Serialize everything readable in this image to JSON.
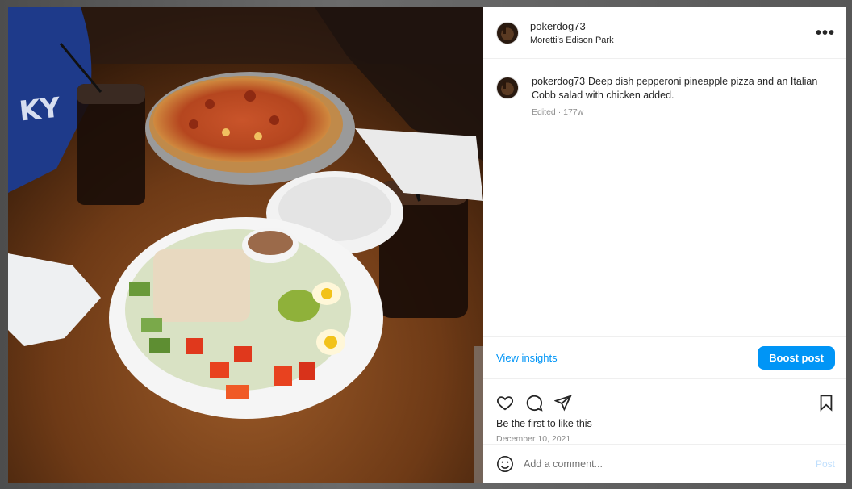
{
  "post": {
    "username": "pokerdog73",
    "location": "Moretti's Edison Park",
    "more_icon": "more-options-icon",
    "caption": {
      "username": "pokerdog73",
      "text": "Deep dish pepperoni pineapple pizza and an Italian Cobb salad with chicken added.",
      "meta": "Edited · 177w"
    },
    "insights_label": "View insights",
    "boost_label": "Boost post",
    "actions": {
      "like_icon": "heart-icon",
      "comment_icon": "comment-icon",
      "share_icon": "share-icon",
      "save_icon": "bookmark-icon"
    },
    "likes_text": "Be the first to like this",
    "date": "December 10, 2021",
    "comment_placeholder": "Add a comment...",
    "post_label": "Post",
    "emoji_icon": "emoji-icon"
  },
  "photo": {
    "subject": "pizza-and-cobb-salad-photo"
  },
  "colors": {
    "accent": "#0095f6",
    "text": "#262626",
    "muted": "#8e8e8e",
    "post_disabled": "#c0dffd"
  }
}
